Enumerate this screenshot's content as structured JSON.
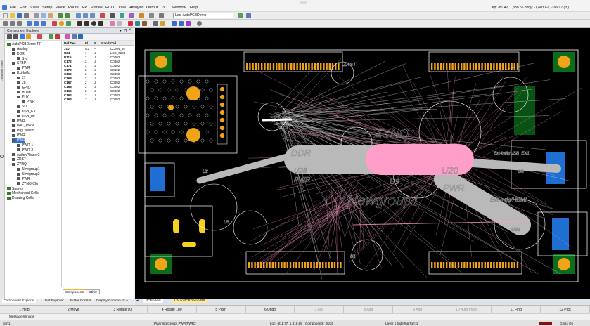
{
  "menu": {
    "items": [
      "File",
      "Edit",
      "View",
      "Setup",
      "Place",
      "Route",
      "FP",
      "Planes",
      "ECO",
      "Draw",
      "Analysis",
      "Output",
      "3D",
      "Window",
      "Help"
    ]
  },
  "toolbar": {
    "design_selector": "Lec: AutoPCBDemo",
    "coordinates": "ep: -81.42, 1,330.55   dxdy: -1,403.62, -396.97 (th)"
  },
  "left_strip": {
    "label": "Constraint Editor"
  },
  "explorer": {
    "title": "Component Explorer",
    "tree": [
      {
        "label": "AutoPCBDemo-PP",
        "indent": 0
      },
      {
        "label": "Analog",
        "indent": 1
      },
      {
        "label": "DDR",
        "indent": 1
      },
      {
        "label": "Sys",
        "indent": 2
      },
      {
        "label": "STBP",
        "indent": 1
      },
      {
        "label": "PWR",
        "indent": 2
      },
      {
        "label": "Ext-Intfc",
        "indent": 1
      },
      {
        "label": "27",
        "indent": 2
      },
      {
        "label": "28",
        "indent": 2
      },
      {
        "label": "GPIO",
        "indent": 2
      },
      {
        "label": "HDMI",
        "indent": 2
      },
      {
        "label": "PHY",
        "indent": 2
      },
      {
        "label": "PWR",
        "indent": 3
      },
      {
        "label": "SD",
        "indent": 2
      },
      {
        "label": "USB_EX",
        "indent": 2
      },
      {
        "label": "USB_Int",
        "indent": 2
      },
      {
        "label": "PWR",
        "indent": 1
      },
      {
        "label": "PAC_PWR",
        "indent": 1
      },
      {
        "label": "PrgCtlMem",
        "indent": 1
      },
      {
        "label": "PWR",
        "indent": 1
      },
      {
        "label": "PWR",
        "indent": 1,
        "selected": true
      },
      {
        "label": "PWR-1",
        "indent": 2
      },
      {
        "label": "PWR-2",
        "indent": 2
      },
      {
        "label": "switchPhaser2",
        "indent": 1
      },
      {
        "label": "ZRST",
        "indent": 1
      },
      {
        "label": "ZYNQ",
        "indent": 1
      },
      {
        "label": "Newgroup1",
        "indent": 2
      },
      {
        "label": "Newgroup2",
        "indent": 2
      },
      {
        "label": "PWR",
        "indent": 2
      },
      {
        "label": "ZYNQ Cfg",
        "indent": 2
      },
      {
        "label": "Spares",
        "indent": 0
      },
      {
        "label": "Mechanical Cells",
        "indent": 0
      },
      {
        "label": "Drawing Cells",
        "indent": 0
      }
    ],
    "grid": {
      "headers": [
        "Ref Des",
        "Fl",
        "P",
        "Stand",
        "Cell"
      ],
      "rows": [
        [
          "J10",
          "G2",
          "P",
          "",
          "CONN_05"
        ],
        [
          "U24",
          "1",
          "U",
          "",
          "LED_0603"
        ],
        [
          "R115",
          "2",
          "U",
          "",
          "C0402"
        ],
        [
          "C172",
          "2",
          "U",
          "",
          "C0402"
        ],
        [
          "C171",
          "2",
          "U",
          "",
          "C0402"
        ],
        [
          "C170",
          "2",
          "U",
          "",
          "C0402"
        ],
        [
          "C169",
          "2",
          "U",
          "",
          "C0402"
        ],
        [
          "C168",
          "2",
          "U",
          "",
          "C0402"
        ],
        [
          "C167",
          "2",
          "U",
          "",
          "C0402"
        ],
        [
          "C166",
          "2",
          "U",
          "",
          "C0402"
        ],
        [
          "C165",
          "2",
          "U",
          "",
          "C0402"
        ],
        [
          "C164",
          "2",
          "U",
          "",
          "C0402"
        ],
        [
          "C163",
          "2",
          "U",
          "",
          "C0402"
        ]
      ]
    },
    "subtabs": [
      "Components",
      "Other"
    ]
  },
  "bottom_tabs": [
    "Component Explorer",
    "Net Explorer",
    "Editor Control",
    "Display Control - 1: A..."
  ],
  "doc_tabs": [
    "PCB View",
    "1:AutoPCBDemo-PP"
  ],
  "function_keys": [
    "1 Help",
    "2 Move",
    "3 Rotate 90",
    "4 Rotate 180",
    "5 Push",
    "6 Undo",
    "7 Add",
    "8 Add",
    "9 Add",
    "10 Auto Place",
    "11 Find",
    "12 Pick"
  ],
  "message_window": {
    "label": "Message Window"
  },
  "status": {
    "left": "Sch1",
    "planning": "Planning Group: PWR/PWR2",
    "location": "Loc: -811.77, 1,318.88",
    "components": "Components: 26/26",
    "layer": "Layer 1 SideTop  Ref: 2",
    "right": "Gloss On"
  },
  "board": {
    "labels": {
      "ddr": "DDR",
      "u28": "U28",
      "pwr_left": "PWR",
      "zynq": "ZYNQ",
      "newgroup": "Newgroup1",
      "u9": "U9",
      "u20": "U20",
      "pwr_right": "PWR",
      "hdmi": "Ext-Intfc/HDMI",
      "usb": "Ext-Intfc/USB_EX1",
      "zrst": "ZRST",
      "u33": "U33",
      "u8": "U8",
      "u1": "U1",
      "u5": "U5",
      "u2": "U2"
    },
    "colors": {
      "background": "#000000",
      "outline": "#ffffff",
      "pad_orange": "#f2a418",
      "highlight_pink": "#ff9ec8",
      "group_grey": "#b9b9b9",
      "connector_green": "#0b6d1b",
      "chip_blue": "#1e6fd1",
      "part_yellow": "#f5d21a"
    }
  }
}
